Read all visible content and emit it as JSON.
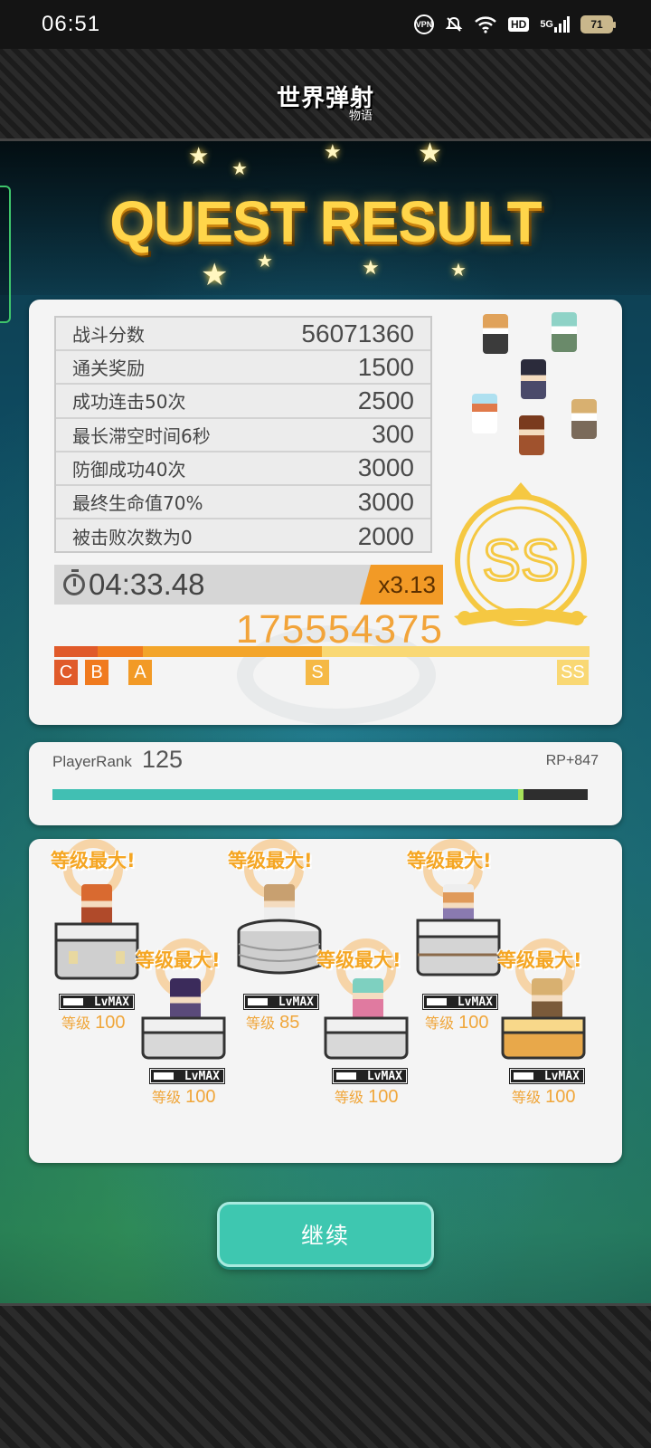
{
  "status_bar": {
    "time": "06:51",
    "icons": [
      "vpn-icon",
      "bell-muted-icon",
      "wifi-icon",
      "hd-icon",
      "signal-5g-icon",
      "battery-icon"
    ],
    "vpn_text": "VPN",
    "hd_text": "HD",
    "network_text": "5G",
    "battery_percent": "71"
  },
  "header": {
    "logo_main": "世界弹射",
    "logo_sub": "物语"
  },
  "title": "QUEST RESULT",
  "result": {
    "rows": [
      {
        "label": "战斗分数",
        "value": "56071360"
      },
      {
        "label": "通关奖励",
        "value": "1500"
      },
      {
        "label": "成功连击50次",
        "value": "2500"
      },
      {
        "label": "最长滞空时间6秒",
        "value": "300"
      },
      {
        "label": "防御成功40次",
        "value": "3000"
      },
      {
        "label": "最终生命值70%",
        "value": "3000"
      },
      {
        "label": "被击败次数为0",
        "value": "2000"
      }
    ],
    "clear_time": "04:33.48",
    "multiplier": "x3.13",
    "total_score": "175554375",
    "rank_grade": "SS",
    "rank_scale": [
      "C",
      "B",
      "A",
      "S",
      "SS"
    ]
  },
  "player_rank": {
    "label": "PlayerRank",
    "value": "125",
    "rp": "RP+847",
    "progress": 0.87
  },
  "team": {
    "max_label": "等级最大!",
    "lv_badge": "LvMAX",
    "level_prefix": "等级",
    "members": [
      {
        "level": "100",
        "max": true
      },
      {
        "level": "100",
        "max": true
      },
      {
        "level": "85",
        "max": true
      },
      {
        "level": "100",
        "max": true
      },
      {
        "level": "100",
        "max": true
      },
      {
        "level": "100",
        "max": true
      }
    ]
  },
  "continue_label": "继续",
  "colors": {
    "accent_orange": "#f29a26",
    "score_gold": "#f2a43a",
    "teal": "#41bfb3",
    "button": "#3ec7b0",
    "title_gold": "#ffd54a"
  }
}
